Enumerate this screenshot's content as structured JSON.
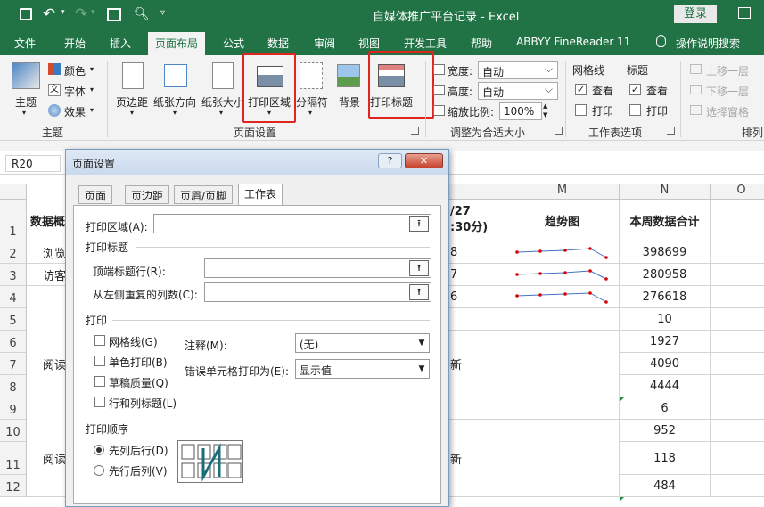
{
  "titlebar": {
    "title": "自媒体推广平台记录  -  Excel",
    "login_label": "登录"
  },
  "menu": [
    "文件",
    "开始",
    "插入",
    "页面布局",
    "公式",
    "数据",
    "审阅",
    "视图",
    "开发工具",
    "帮助",
    "ABBYY FineReader 11",
    "操作说明搜索"
  ],
  "ribbon": {
    "theme": {
      "themes_label": "主题",
      "colors_label": "颜色",
      "fonts_label": "字体",
      "effects_label": "效果",
      "group_label": "主题"
    },
    "page_setup": {
      "margins_label": "页边距",
      "orientation_label": "纸张方向",
      "size_label": "纸张大小",
      "print_area_label": "打印区域",
      "breaks_label": "分隔符",
      "background_label": "背景",
      "print_titles_label": "打印标题",
      "group_label": "页面设置"
    },
    "scale": {
      "width_label": "宽度:",
      "width_value": "自动",
      "height_label": "高度:",
      "height_value": "自动",
      "scale_label": "缩放比例:",
      "scale_value": "100%",
      "group_label": "调整为合适大小"
    },
    "sheet_options": {
      "gridlines_label": "网格线",
      "headings_label": "标题",
      "view_label": "查看",
      "print_label": "打印",
      "group_label": "工作表选项"
    },
    "arrange": {
      "bring_forward_label": "上移一层",
      "send_backward_label": "下移一层",
      "selection_pane_label": "选择窗格",
      "group_label": "排列"
    }
  },
  "namebox": "R20",
  "grid": {
    "columns": [
      "M",
      "N",
      "O"
    ],
    "rows": [
      "1",
      "2",
      "3",
      "4",
      "5",
      "6",
      "7",
      "8",
      "9",
      "10",
      "11",
      "12"
    ],
    "col_a_cells": [
      "数据概",
      "浏览",
      "访客",
      "",
      "",
      "",
      "阅读",
      "",
      "",
      "",
      "阅读",
      ""
    ],
    "l_header": "/27\n:30分)",
    "l_cells": [
      "8",
      "7",
      "6",
      "",
      "",
      "新",
      "",
      "",
      "",
      "新",
      ""
    ],
    "m_header": "趋势图",
    "n_header": "本周数据合计",
    "n_values": [
      "398699",
      "280958",
      "276618",
      "10",
      "1927",
      "4090",
      "4444",
      "6",
      "952",
      "118",
      "484"
    ]
  },
  "dialog": {
    "title": "页面设置",
    "tabs": [
      "页面",
      "页边距",
      "页眉/页脚",
      "工作表"
    ],
    "print_area_label": "打印区域(A):",
    "print_titles_heading": "打印标题",
    "rows_repeat_label": "顶端标题行(R):",
    "cols_repeat_label": "从左侧重复的列数(C):",
    "print_heading": "打印",
    "gridlines_label": "网格线(G)",
    "bw_label": "单色打印(B)",
    "draft_label": "草稿质量(Q)",
    "headings_label": "行和列标题(L)",
    "comments_label": "注释(M):",
    "comments_value": "(无)",
    "errors_label": "错误单元格打印为(E):",
    "errors_value": "显示值",
    "order_heading": "打印顺序",
    "down_then_over_label": "先列后行(D)",
    "over_then_down_label": "先行后列(V)"
  }
}
